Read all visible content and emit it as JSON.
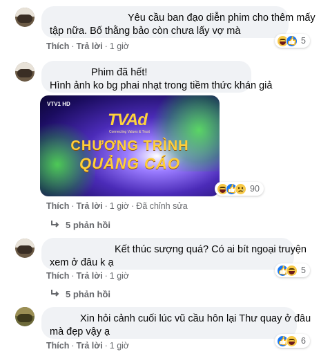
{
  "comments": [
    {
      "lines": [
        "Yêu cầu ban đạo diễn phim cho thêm mấy",
        "tập nữa. Bố thằng bảo còn chưa lấy vợ mà"
      ],
      "actions": {
        "like": "Thích",
        "reply": "Trả lời",
        "time": "1 giờ"
      },
      "reactions": {
        "icons": [
          "haha",
          "like"
        ],
        "count": "5"
      }
    },
    {
      "lines": [
        "Phim đã hết!",
        "Hình ảnh ko bg phai nhạt trong tiềm thức khán giả"
      ],
      "media": {
        "channel": "VTV1 HD",
        "brand": "TVAd",
        "tagline": "Connecting Values & Trust",
        "title_line1": "CHƯƠNG TRÌNH",
        "title_line2": "QUẢNG CÁO"
      },
      "actions": {
        "like": "Thích",
        "reply": "Trả lời",
        "time": "1 giờ",
        "edited": "Đã chỉnh sửa"
      },
      "reactions": {
        "icons": [
          "haha",
          "like",
          "sad"
        ],
        "count": "90"
      },
      "replies": "5 phản hồi"
    },
    {
      "lines": [
        "Kết thúc sượng quá? Có ai bít ngoại truyện",
        "xem ở đâu k ạ"
      ],
      "actions": {
        "like": "Thích",
        "reply": "Trả lời",
        "time": "1 giờ"
      },
      "reactions": {
        "icons": [
          "like",
          "haha"
        ],
        "count": "5"
      },
      "replies": "5 phản hồi"
    },
    {
      "lines": [
        "Xin hỏi cảnh cuối lúc vũ cầu hôn lại Thư quay ở đâu",
        "mà đẹp vậy ạ"
      ],
      "actions": {
        "like": "Thích",
        "reply": "Trả lời",
        "time": "1 giờ"
      },
      "reactions": {
        "icons": [
          "like",
          "haha"
        ],
        "count": "6"
      }
    }
  ],
  "colors": {
    "bubble": "#f0f2f5",
    "meta_text": "#65676b",
    "like_blue": "#1877f2",
    "haha_yellow": "#f7c948"
  }
}
